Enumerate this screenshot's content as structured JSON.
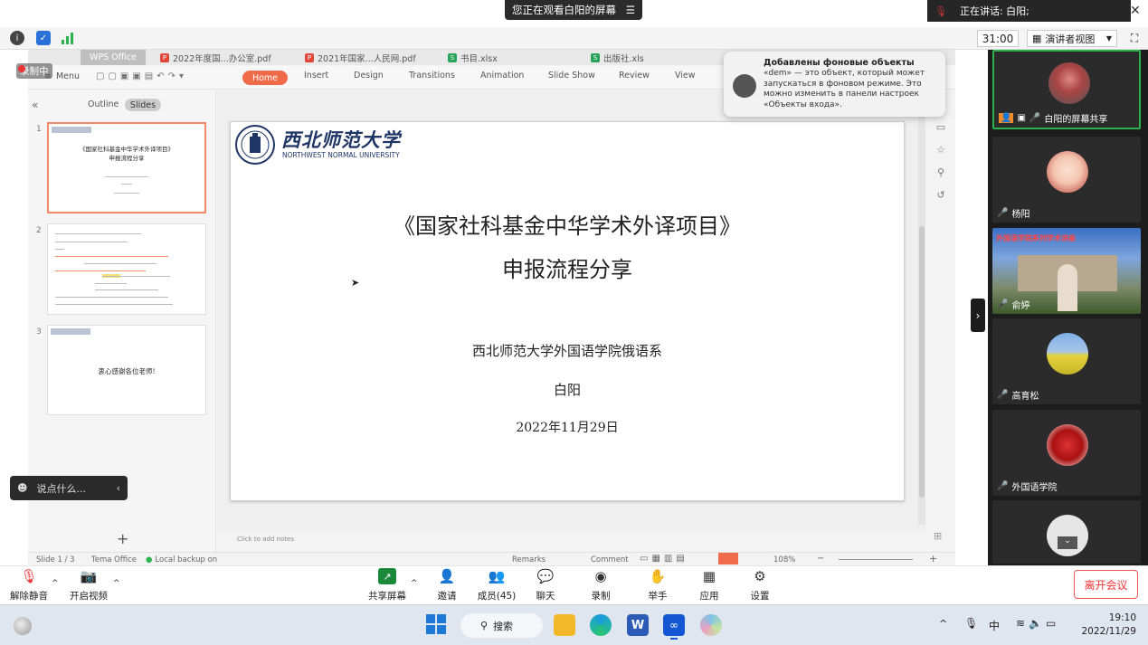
{
  "banner": {
    "viewing_text": "您正在观看白阳的屏幕",
    "speaking_text": "正在讲话: 白阳;"
  },
  "meeting_toolbar": {
    "timer": "31:00",
    "view_mode": "演讲者视图"
  },
  "recording_label": "录制中",
  "wps": {
    "app_tab": "WPS Office",
    "doc_tabs": [
      "2022年度国...办公室.pdf",
      "2021年国家...人民网.pdf",
      "书目.xlsx",
      "出版社.xls"
    ],
    "menu_label": "Menu",
    "ribbon_tabs": [
      "Home",
      "Insert",
      "Design",
      "Transitions",
      "Animation",
      "Slide Show",
      "Review",
      "View"
    ],
    "panel_tabs": {
      "outline": "Outline",
      "slides": "Slides"
    },
    "thumbs": [
      {
        "num": "1",
        "title": "《国家社科基金中华学术外译项目》",
        "subtitle": "申报流程分享"
      },
      {
        "num": "2"
      },
      {
        "num": "3",
        "text": "衷心感谢各位老师!"
      }
    ],
    "status": {
      "slide_count": "Slide 1 / 3",
      "theme": "Tema Office",
      "backup": "Local backup on",
      "remarks": "Remarks",
      "comment": "Comment",
      "zoom": "108%",
      "notes_placeholder": "Click to add notes"
    }
  },
  "slide": {
    "logo_cn": "西北师范大学",
    "logo_en": "NORTHWEST NORMAL UNIVERSITY",
    "title": "《国家社科基金中华学术外译项目》",
    "subtitle": "申报流程分享",
    "department": "西北师范大学外国语学院俄语系",
    "author": "白阳",
    "date": "2022年11月29日"
  },
  "notification": {
    "title": "Добавлены фоновые объекты",
    "body": "«dem» — это объект, который может запускаться в фоновом режиме. Это можно изменить в панели настроек «Объекты входа»."
  },
  "participants": [
    {
      "name": "白阳的屏幕共享",
      "muted": false
    },
    {
      "name": "杨阳",
      "muted": true
    },
    {
      "name": "俞婷",
      "muted": false,
      "banner": "外国语学院系列学术讲座"
    },
    {
      "name": "高育松",
      "muted": false
    },
    {
      "name": "外国语学院",
      "muted": true
    },
    {
      "name": "",
      "muted": true
    }
  ],
  "chat_placeholder": "说点什么...",
  "bottom_bar": {
    "unmute": "解除静音",
    "start_video": "开启视频",
    "share_screen": "共享屏幕",
    "invite": "邀请",
    "members": "成员(45)",
    "chat": "聊天",
    "record": "录制",
    "raise_hand": "举手",
    "apps": "应用",
    "settings": "设置",
    "leave": "离开会议"
  },
  "taskbar": {
    "search": "搜索",
    "ime": "中",
    "time": "19:10",
    "date": "2022/11/29"
  },
  "colors": {
    "accent": "#f06b4a",
    "leave": "#e33333",
    "gallery_bg": "#1c1c1c"
  }
}
